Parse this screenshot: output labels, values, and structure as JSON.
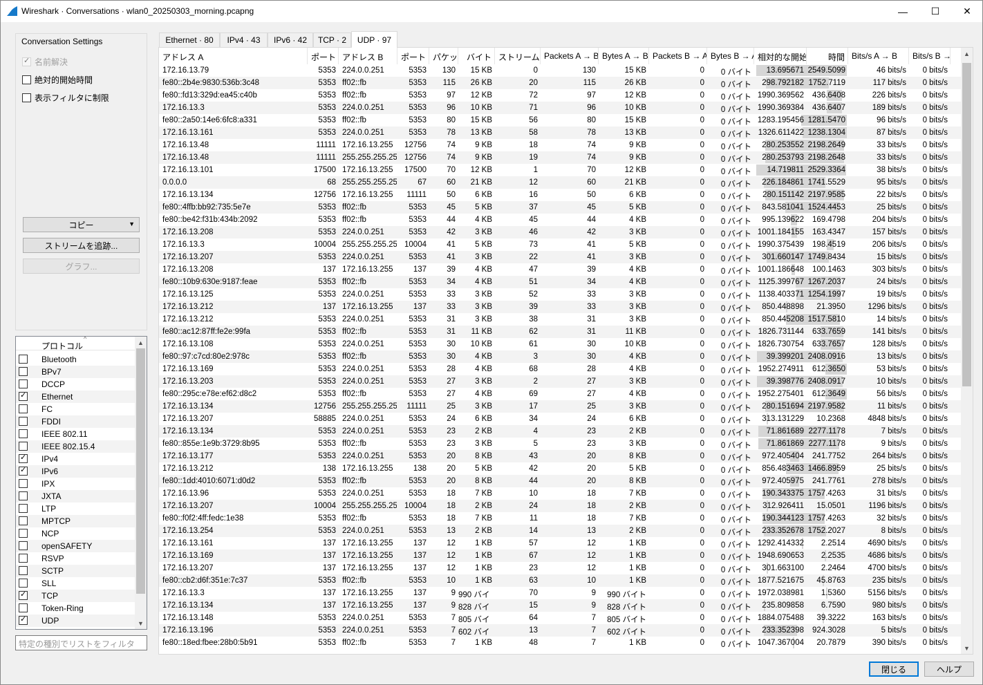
{
  "window": {
    "title": "Wireshark · Conversations · wlan0_20250303_morning.pcapng",
    "minimize": "—",
    "maximize": "☐",
    "close": "✕"
  },
  "settings": {
    "title": "Conversation Settings",
    "name_resolution": "名前解決",
    "absolute_start": "絶対的開始時間",
    "limit_filter": "表示フィルタに制限",
    "copy_button": "コピー",
    "follow_stream_button": "ストリームを追跡...",
    "graph_button": "グラフ..."
  },
  "protocols": {
    "header": "プロトコル",
    "items": [
      {
        "name": "Bluetooth",
        "checked": false
      },
      {
        "name": "BPv7",
        "checked": false
      },
      {
        "name": "DCCP",
        "checked": false
      },
      {
        "name": "Ethernet",
        "checked": true
      },
      {
        "name": "FC",
        "checked": false
      },
      {
        "name": "FDDI",
        "checked": false
      },
      {
        "name": "IEEE 802.11",
        "checked": false
      },
      {
        "name": "IEEE 802.15.4",
        "checked": false
      },
      {
        "name": "IPv4",
        "checked": true
      },
      {
        "name": "IPv6",
        "checked": true
      },
      {
        "name": "IPX",
        "checked": false
      },
      {
        "name": "JXTA",
        "checked": false
      },
      {
        "name": "LTP",
        "checked": false
      },
      {
        "name": "MPTCP",
        "checked": false
      },
      {
        "name": "NCP",
        "checked": false
      },
      {
        "name": "openSAFETY",
        "checked": false
      },
      {
        "name": "RSVP",
        "checked": false
      },
      {
        "name": "SCTP",
        "checked": false
      },
      {
        "name": "SLL",
        "checked": false
      },
      {
        "name": "TCP",
        "checked": true
      },
      {
        "name": "Token-Ring",
        "checked": false
      },
      {
        "name": "UDP",
        "checked": true
      }
    ],
    "filter_placeholder": "特定の種別でリストをフィルタ"
  },
  "tabs": [
    "Ethernet · 80",
    "IPv4 · 43",
    "IPv6 · 42",
    "TCP · 2",
    "UDP · 97"
  ],
  "active_tab": 4,
  "columns": [
    "アドレス A",
    "ポート A",
    "アドレス B",
    "ポート B",
    "パケット",
    "バイト",
    "ストリームID",
    "Packets A → B",
    "Bytes A → B",
    "Packets B → A",
    "Bytes B → A",
    "相対的な開始",
    "時間",
    "Bits/s A → B",
    "Bits/s B → A"
  ],
  "rows": [
    [
      "172.16.13.79",
      "5353",
      "224.0.0.251",
      "5353",
      "130",
      "15 KB",
      "0",
      "130",
      "15 KB",
      "0",
      "0 バイト",
      "13.695671",
      "2549.5099",
      "46 bits/s",
      "0 bits/s"
    ],
    [
      "fe80::2b4e:9830:536b:3c48",
      "5353",
      "ff02::fb",
      "5353",
      "115",
      "26 KB",
      "20",
      "115",
      "26 KB",
      "0",
      "0 バイト",
      "298.792182",
      "1752.7119",
      "117 bits/s",
      "0 bits/s"
    ],
    [
      "fe80::fd13:329d:ea45:c40b",
      "5353",
      "ff02::fb",
      "5353",
      "97",
      "12 KB",
      "72",
      "97",
      "12 KB",
      "0",
      "0 バイト",
      "1990.369562",
      "436.6408",
      "226 bits/s",
      "0 bits/s"
    ],
    [
      "172.16.13.3",
      "5353",
      "224.0.0.251",
      "5353",
      "96",
      "10 KB",
      "71",
      "96",
      "10 KB",
      "0",
      "0 バイト",
      "1990.369384",
      "436.6407",
      "189 bits/s",
      "0 bits/s"
    ],
    [
      "fe80::2a50:14e6:6fc8:a331",
      "5353",
      "ff02::fb",
      "5353",
      "80",
      "15 KB",
      "56",
      "80",
      "15 KB",
      "0",
      "0 バイト",
      "1283.195456",
      "1281.5470",
      "96 bits/s",
      "0 bits/s"
    ],
    [
      "172.16.13.161",
      "5353",
      "224.0.0.251",
      "5353",
      "78",
      "13 KB",
      "58",
      "78",
      "13 KB",
      "0",
      "0 バイト",
      "1326.611422",
      "1238.1304",
      "87 bits/s",
      "0 bits/s"
    ],
    [
      "172.16.13.48",
      "11111",
      "172.16.13.255",
      "12756",
      "74",
      "9 KB",
      "18",
      "74",
      "9 KB",
      "0",
      "0 バイト",
      "280.253552",
      "2198.2649",
      "33 bits/s",
      "0 bits/s"
    ],
    [
      "172.16.13.48",
      "11111",
      "255.255.255.255",
      "12756",
      "74",
      "9 KB",
      "19",
      "74",
      "9 KB",
      "0",
      "0 バイト",
      "280.253793",
      "2198.2648",
      "33 bits/s",
      "0 bits/s"
    ],
    [
      "172.16.13.101",
      "17500",
      "172.16.13.255",
      "17500",
      "70",
      "12 KB",
      "1",
      "70",
      "12 KB",
      "0",
      "0 バイト",
      "14.719811",
      "2529.3364",
      "38 bits/s",
      "0 bits/s"
    ],
    [
      "0.0.0.0",
      "68",
      "255.255.255.255",
      "67",
      "60",
      "21 KB",
      "12",
      "60",
      "21 KB",
      "0",
      "0 バイト",
      "226.184861",
      "1741.5529",
      "95 bits/s",
      "0 bits/s"
    ],
    [
      "172.16.13.134",
      "12756",
      "172.16.13.255",
      "11111",
      "50",
      "6 KB",
      "16",
      "50",
      "6 KB",
      "0",
      "0 バイト",
      "280.151142",
      "2197.9585",
      "22 bits/s",
      "0 bits/s"
    ],
    [
      "fe80::4ffb:bb92:735:5e7e",
      "5353",
      "ff02::fb",
      "5353",
      "45",
      "5 KB",
      "37",
      "45",
      "5 KB",
      "0",
      "0 バイト",
      "843.581041",
      "1524.4453",
      "25 bits/s",
      "0 bits/s"
    ],
    [
      "fe80::be42:f31b:434b:2092",
      "5353",
      "ff02::fb",
      "5353",
      "44",
      "4 KB",
      "45",
      "44",
      "4 KB",
      "0",
      "0 バイト",
      "995.139622",
      "169.4798",
      "204 bits/s",
      "0 bits/s"
    ],
    [
      "172.16.13.208",
      "5353",
      "224.0.0.251",
      "5353",
      "42",
      "3 KB",
      "46",
      "42",
      "3 KB",
      "0",
      "0 バイト",
      "1001.184155",
      "163.4347",
      "157 bits/s",
      "0 bits/s"
    ],
    [
      "172.16.13.3",
      "10004",
      "255.255.255.255",
      "10004",
      "41",
      "5 KB",
      "73",
      "41",
      "5 KB",
      "0",
      "0 バイト",
      "1990.375439",
      "198.4519",
      "206 bits/s",
      "0 bits/s"
    ],
    [
      "172.16.13.207",
      "5353",
      "224.0.0.251",
      "5353",
      "41",
      "3 KB",
      "22",
      "41",
      "3 KB",
      "0",
      "0 バイト",
      "301.660147",
      "1749.8434",
      "15 bits/s",
      "0 bits/s"
    ],
    [
      "172.16.13.208",
      "137",
      "172.16.13.255",
      "137",
      "39",
      "4 KB",
      "47",
      "39",
      "4 KB",
      "0",
      "0 バイト",
      "1001.186648",
      "100.1463",
      "303 bits/s",
      "0 bits/s"
    ],
    [
      "fe80::10b9:630e:9187:feae",
      "5353",
      "ff02::fb",
      "5353",
      "34",
      "4 KB",
      "51",
      "34",
      "4 KB",
      "0",
      "0 バイト",
      "1125.399767",
      "1267.2037",
      "24 bits/s",
      "0 bits/s"
    ],
    [
      "172.16.13.125",
      "5353",
      "224.0.0.251",
      "5353",
      "33",
      "3 KB",
      "52",
      "33",
      "3 KB",
      "0",
      "0 バイト",
      "1138.403371",
      "1254.1997",
      "19 bits/s",
      "0 bits/s"
    ],
    [
      "172.16.13.212",
      "137",
      "172.16.13.255",
      "137",
      "33",
      "3 KB",
      "39",
      "33",
      "3 KB",
      "0",
      "0 バイト",
      "850.448898",
      "21.3950",
      "1296 bits/s",
      "0 bits/s"
    ],
    [
      "172.16.13.212",
      "5353",
      "224.0.0.251",
      "5353",
      "31",
      "3 KB",
      "38",
      "31",
      "3 KB",
      "0",
      "0 バイト",
      "850.445208",
      "1517.5810",
      "14 bits/s",
      "0 bits/s"
    ],
    [
      "fe80::ac12:87ff:fe2e:99fa",
      "5353",
      "ff02::fb",
      "5353",
      "31",
      "11 KB",
      "62",
      "31",
      "11 KB",
      "0",
      "0 バイト",
      "1826.731144",
      "633.7659",
      "141 bits/s",
      "0 bits/s"
    ],
    [
      "172.16.13.108",
      "5353",
      "224.0.0.251",
      "5353",
      "30",
      "10 KB",
      "61",
      "30",
      "10 KB",
      "0",
      "0 バイト",
      "1826.730754",
      "633.7657",
      "128 bits/s",
      "0 bits/s"
    ],
    [
      "fe80::97:c7cd:80e2:978c",
      "5353",
      "ff02::fb",
      "5353",
      "30",
      "4 KB",
      "3",
      "30",
      "4 KB",
      "0",
      "0 バイト",
      "39.399201",
      "2408.0916",
      "13 bits/s",
      "0 bits/s"
    ],
    [
      "172.16.13.169",
      "5353",
      "224.0.0.251",
      "5353",
      "28",
      "4 KB",
      "68",
      "28",
      "4 KB",
      "0",
      "0 バイト",
      "1952.274911",
      "612.3650",
      "53 bits/s",
      "0 bits/s"
    ],
    [
      "172.16.13.203",
      "5353",
      "224.0.0.251",
      "5353",
      "27",
      "3 KB",
      "2",
      "27",
      "3 KB",
      "0",
      "0 バイト",
      "39.398776",
      "2408.0917",
      "10 bits/s",
      "0 bits/s"
    ],
    [
      "fe80::295c:e78e:ef62:d8c2",
      "5353",
      "ff02::fb",
      "5353",
      "27",
      "4 KB",
      "69",
      "27",
      "4 KB",
      "0",
      "0 バイト",
      "1952.275401",
      "612.3649",
      "56 bits/s",
      "0 bits/s"
    ],
    [
      "172.16.13.134",
      "12756",
      "255.255.255.255",
      "11111",
      "25",
      "3 KB",
      "17",
      "25",
      "3 KB",
      "0",
      "0 バイト",
      "280.151694",
      "2197.9582",
      "11 bits/s",
      "0 bits/s"
    ],
    [
      "172.16.13.207",
      "58885",
      "224.0.0.251",
      "5353",
      "24",
      "6 KB",
      "34",
      "24",
      "6 KB",
      "0",
      "0 バイト",
      "313.131229",
      "10.2368",
      "4848 bits/s",
      "0 bits/s"
    ],
    [
      "172.16.13.134",
      "5353",
      "224.0.0.251",
      "5353",
      "23",
      "2 KB",
      "4",
      "23",
      "2 KB",
      "0",
      "0 バイト",
      "71.861689",
      "2277.1178",
      "7 bits/s",
      "0 bits/s"
    ],
    [
      "fe80::855e:1e9b:3729:8b95",
      "5353",
      "ff02::fb",
      "5353",
      "23",
      "3 KB",
      "5",
      "23",
      "3 KB",
      "0",
      "0 バイト",
      "71.861869",
      "2277.1178",
      "9 bits/s",
      "0 bits/s"
    ],
    [
      "172.16.13.177",
      "5353",
      "224.0.0.251",
      "5353",
      "20",
      "8 KB",
      "43",
      "20",
      "8 KB",
      "0",
      "0 バイト",
      "972.405404",
      "241.7752",
      "264 bits/s",
      "0 bits/s"
    ],
    [
      "172.16.13.212",
      "138",
      "172.16.13.255",
      "138",
      "20",
      "5 KB",
      "42",
      "20",
      "5 KB",
      "0",
      "0 バイト",
      "856.483463",
      "1466.8959",
      "25 bits/s",
      "0 bits/s"
    ],
    [
      "fe80::1dd:4010:6071:d0d2",
      "5353",
      "ff02::fb",
      "5353",
      "20",
      "8 KB",
      "44",
      "20",
      "8 KB",
      "0",
      "0 バイト",
      "972.405975",
      "241.7761",
      "278 bits/s",
      "0 bits/s"
    ],
    [
      "172.16.13.96",
      "5353",
      "224.0.0.251",
      "5353",
      "18",
      "7 KB",
      "10",
      "18",
      "7 KB",
      "0",
      "0 バイト",
      "190.343375",
      "1757.4263",
      "31 bits/s",
      "0 bits/s"
    ],
    [
      "172.16.13.207",
      "10004",
      "255.255.255.255",
      "10004",
      "18",
      "2 KB",
      "24",
      "18",
      "2 KB",
      "0",
      "0 バイト",
      "312.926411",
      "15.0501",
      "1196 bits/s",
      "0 bits/s"
    ],
    [
      "fe80::f0f2:4ff:fedc:1e38",
      "5353",
      "ff02::fb",
      "5353",
      "18",
      "7 KB",
      "11",
      "18",
      "7 KB",
      "0",
      "0 バイト",
      "190.344123",
      "1757.4263",
      "32 bits/s",
      "0 bits/s"
    ],
    [
      "172.16.13.254",
      "5353",
      "224.0.0.251",
      "5353",
      "13",
      "2 KB",
      "14",
      "13",
      "2 KB",
      "0",
      "0 バイト",
      "233.352678",
      "1752.2027",
      "8 bits/s",
      "0 bits/s"
    ],
    [
      "172.16.13.161",
      "137",
      "172.16.13.255",
      "137",
      "12",
      "1 KB",
      "57",
      "12",
      "1 KB",
      "0",
      "0 バイト",
      "1292.414332",
      "2.2514",
      "4690 bits/s",
      "0 bits/s"
    ],
    [
      "172.16.13.169",
      "137",
      "172.16.13.255",
      "137",
      "12",
      "1 KB",
      "67",
      "12",
      "1 KB",
      "0",
      "0 バイト",
      "1948.690653",
      "2.2535",
      "4686 bits/s",
      "0 bits/s"
    ],
    [
      "172.16.13.207",
      "137",
      "172.16.13.255",
      "137",
      "12",
      "1 KB",
      "23",
      "12",
      "1 KB",
      "0",
      "0 バイト",
      "301.663100",
      "2.2464",
      "4700 bits/s",
      "0 bits/s"
    ],
    [
      "fe80::cb2:d6f:351e:7c37",
      "5353",
      "ff02::fb",
      "5353",
      "10",
      "1 KB",
      "63",
      "10",
      "1 KB",
      "0",
      "0 バイト",
      "1877.521675",
      "45.8763",
      "235 bits/s",
      "0 bits/s"
    ],
    [
      "172.16.13.3",
      "137",
      "172.16.13.255",
      "137",
      "9",
      "990 バイト",
      "70",
      "9",
      "990 バイト",
      "0",
      "0 バイト",
      "1972.038981",
      "1.5360",
      "5156 bits/s",
      "0 bits/s"
    ],
    [
      "172.16.13.134",
      "137",
      "172.16.13.255",
      "137",
      "9",
      "828 バイト",
      "15",
      "9",
      "828 バイト",
      "0",
      "0 バイト",
      "235.809858",
      "6.7590",
      "980 bits/s",
      "0 bits/s"
    ],
    [
      "172.16.13.148",
      "5353",
      "224.0.0.251",
      "5353",
      "7",
      "805 バイト",
      "64",
      "7",
      "805 バイト",
      "0",
      "0 バイト",
      "1884.075488",
      "39.3222",
      "163 bits/s",
      "0 bits/s"
    ],
    [
      "172.16.13.196",
      "5353",
      "224.0.0.251",
      "5353",
      "7",
      "602 バイト",
      "13",
      "7",
      "602 バイト",
      "0",
      "0 バイト",
      "233.352398",
      "924.3028",
      "5 bits/s",
      "0 bits/s"
    ],
    [
      "fe80::18ed:fbee:28b0:5b91",
      "5353",
      "ff02::fb",
      "5353",
      "7",
      "1 KB",
      "48",
      "7",
      "1 KB",
      "0",
      "0 バイト",
      "1047.367004",
      "20.7879",
      "390 bits/s",
      "0 bits/s"
    ]
  ],
  "buttons": {
    "close": "閉じる",
    "help": "ヘルプ"
  }
}
